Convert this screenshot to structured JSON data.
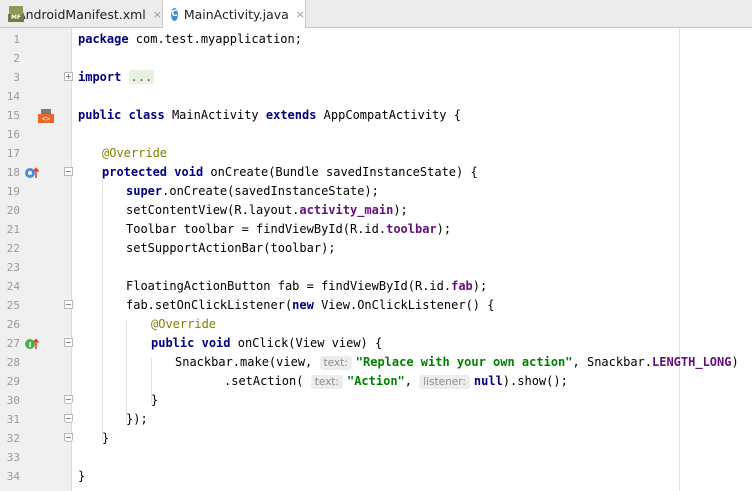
{
  "tabs": [
    {
      "label": "AndroidManifest.xml",
      "icon": "manifest-file-icon",
      "icon_label": "MF",
      "close": "×",
      "active": false
    },
    {
      "label": "MainActivity.java",
      "icon": "java-class-icon",
      "icon_label": "C",
      "close": "×",
      "active": true
    }
  ],
  "hints": {
    "text": "text:",
    "listener": "listener:"
  },
  "lines": {
    "l1": {
      "num": "1",
      "package_kw": "package",
      "rest": " com.test.myapplication;"
    },
    "l2": {
      "num": "2"
    },
    "l3": {
      "num": "3",
      "import_kw": "import",
      "collapsed": "..."
    },
    "l14": {
      "num": "14"
    },
    "l15": {
      "num": "15",
      "kw1": "public",
      "kw2": "class",
      "name": " MainActivity ",
      "kw3": "extends",
      "rest": " AppCompatActivity {"
    },
    "l16": {
      "num": "16"
    },
    "l17": {
      "num": "17",
      "ann": "@Override"
    },
    "l18": {
      "num": "18",
      "kw1": "protected",
      "kw2": "void",
      "rest": " onCreate(Bundle savedInstanceState) {"
    },
    "l19": {
      "num": "19",
      "kw": "super",
      "rest": ".onCreate(savedInstanceState);"
    },
    "l20": {
      "num": "20",
      "pre": "setContentView(R.layout.",
      "field": "activity_main",
      "post": ");"
    },
    "l21": {
      "num": "21",
      "pre": "Toolbar toolbar = findViewById(R.id.",
      "field": "toolbar",
      "post": ");"
    },
    "l22": {
      "num": "22",
      "text": "setSupportActionBar(toolbar);"
    },
    "l23": {
      "num": "23"
    },
    "l24": {
      "num": "24",
      "pre": "FloatingActionButton fab = findViewById(R.id.",
      "field": "fab",
      "post": ");"
    },
    "l25": {
      "num": "25",
      "pre": "fab.setOnClickListener(",
      "kw": "new",
      "post": " View.OnClickListener() {"
    },
    "l26": {
      "num": "26",
      "ann": "@Override"
    },
    "l27": {
      "num": "27",
      "kw1": "public",
      "kw2": "void",
      "rest": " onClick(View view) {"
    },
    "l28": {
      "num": "28",
      "pre": "Snackbar.make(view, ",
      "str": "\"Replace with your own action\"",
      "mid": ", Snackbar.",
      "field": "LENGTH_LONG",
      "post": ")"
    },
    "l29": {
      "num": "29",
      "pre": ".setAction( ",
      "str": "\"Action\"",
      "mid": ", ",
      "kw": "null",
      "post": ").show();"
    },
    "l30": {
      "num": "30",
      "text": "}"
    },
    "l31": {
      "num": "31",
      "text": "});"
    },
    "l32": {
      "num": "32",
      "text": "}"
    },
    "l33": {
      "num": "33"
    },
    "l34": {
      "num": "34",
      "text": "}"
    }
  },
  "colors": {
    "keyword": "#000080",
    "annotation": "#808000",
    "string": "#008000",
    "field": "#660e7a"
  }
}
